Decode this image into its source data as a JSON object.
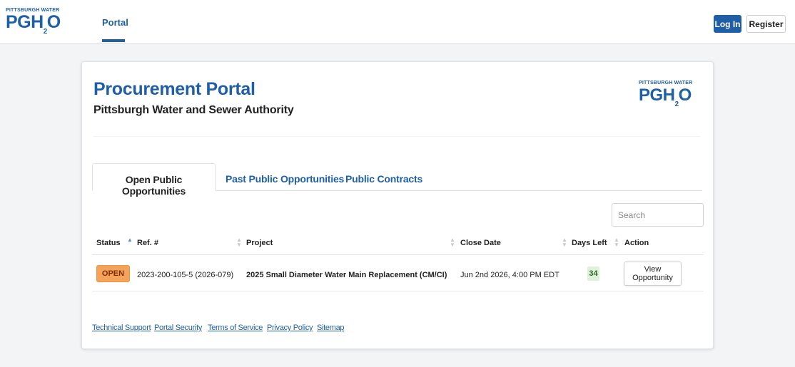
{
  "header": {
    "logo_small": "PITTSBURGH WATER",
    "logo_big_pre": "PGH",
    "logo_big_sub": "2",
    "logo_big_post": "O",
    "nav_tab": "Portal",
    "login_label": "Log In",
    "register_label": "Register"
  },
  "card": {
    "title": "Procurement Portal",
    "subtitle": "Pittsburgh Water and Sewer Authority",
    "logo_small": "PITTSBURGH WATER",
    "logo_big_pre": "PGH",
    "logo_big_sub": "2",
    "logo_big_post": "O"
  },
  "tabs": [
    {
      "label": "Open Public Opportunities",
      "active": true
    },
    {
      "label": "Past Public Opportunities",
      "active": false
    },
    {
      "label": "Public Contracts",
      "active": false
    }
  ],
  "search": {
    "placeholder": "Search"
  },
  "table": {
    "columns": [
      "Status",
      "Ref. #",
      "Project",
      "Close Date",
      "Days Left",
      "Action"
    ],
    "rows": [
      {
        "status": "OPEN",
        "ref": "2023-200-105-5 (2026-079)",
        "project": "2025 Small Diameter Water Main Replacement (CM/CI)",
        "close_date": "Jun 2nd 2026, 4:00 PM EDT",
        "days_left": "34",
        "action": "View Opportunity"
      }
    ]
  },
  "footer_links": [
    "Technical Support",
    "Portal Security",
    "Terms of Service",
    "Privacy Policy",
    "Sitemap"
  ],
  "colors": {
    "brand": "#1f5fa8",
    "open_badge": "#f5a35b",
    "days_badge": "#dff1d9"
  }
}
